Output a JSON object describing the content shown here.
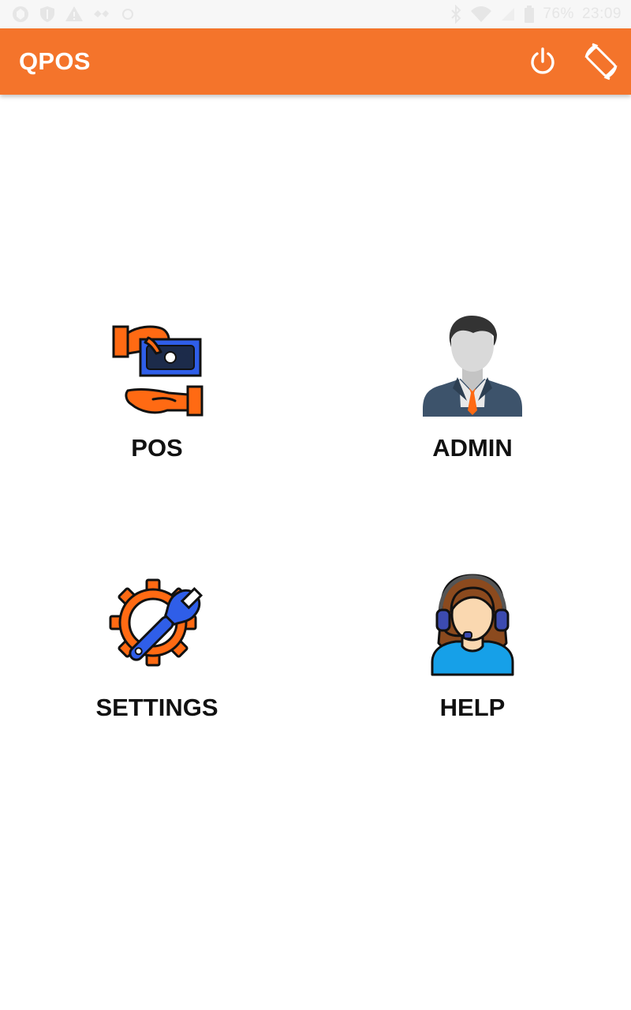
{
  "status_bar": {
    "battery": "76%",
    "time": "23:09",
    "icons": [
      "notification-icon",
      "shield-icon",
      "warning-icon",
      "sync-icon",
      "vpn-icon",
      "bluetooth-icon",
      "wifi-icon",
      "signal-icon",
      "battery-icon"
    ]
  },
  "app_bar": {
    "title": "QPOS",
    "background": "#f4742b",
    "actions": [
      "power-icon",
      "screen-rotation-icon"
    ]
  },
  "menu": {
    "tiles": [
      {
        "label": "POS",
        "icon": "cash-payment-icon"
      },
      {
        "label": "ADMIN",
        "icon": "admin-person-icon"
      },
      {
        "label": "SETTINGS",
        "icon": "gear-wrench-icon"
      },
      {
        "label": "HELP",
        "icon": "support-agent-icon"
      }
    ]
  },
  "colors": {
    "accent": "#f4742b",
    "icon_blue": "#2f5ee8",
    "icon_orange": "#ff6a13",
    "label": "#111111"
  }
}
